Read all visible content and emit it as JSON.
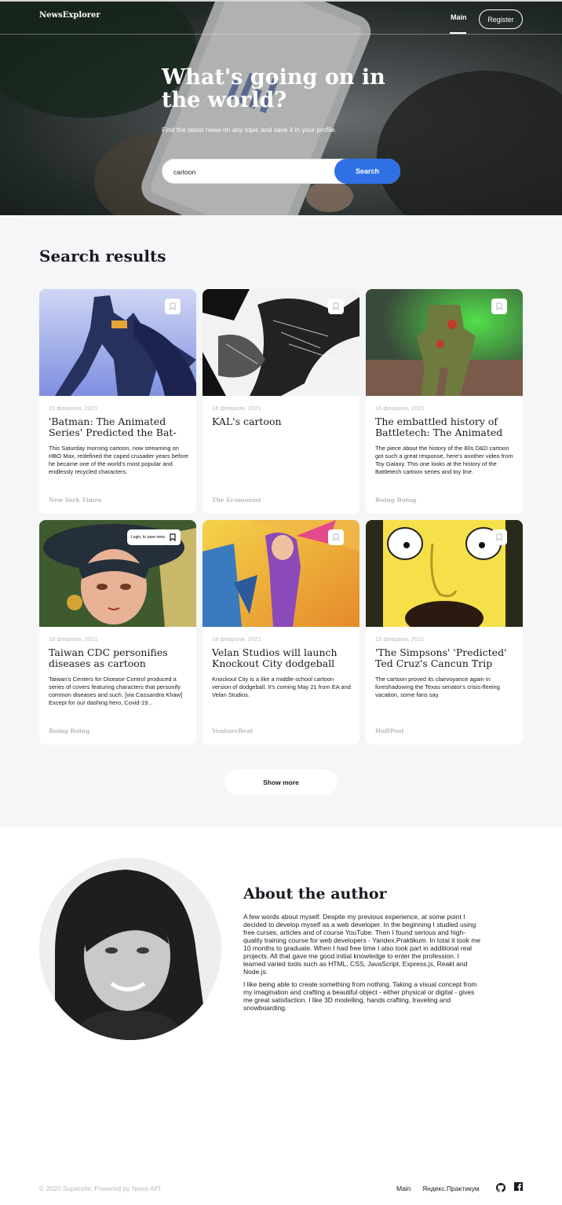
{
  "header": {
    "logo": "NewsExplorer",
    "nav_main": "Main",
    "register": "Register"
  },
  "hero": {
    "title": "What's going on in the world?",
    "subtitle": "Find the latest news on any topic and save it in your profile.",
    "search_value": "cartoon",
    "search_button": "Search"
  },
  "results": {
    "title": "Search results",
    "tooltip": "Login, to save news",
    "show_more": "Show more",
    "cards": [
      {
        "date": "21 февраля, 2021",
        "title": "'Batman: The Animated Series' Predicted the Bat-Family",
        "text": "This Saturday morning cartoon, now streaming on HBO Max, redefined the caped crusader years before he became one of the world's most popular and endlessly recycled characters.",
        "source": "New York Times",
        "icon": "bookmark-icon"
      },
      {
        "date": "18 февраля, 2021",
        "title": "KAL's cartoon",
        "text": "",
        "source": "The Economist",
        "icon": "bookmark-icon"
      },
      {
        "date": "16 февраля, 2021",
        "title": "The embattled history of Battletech: The Animated Series",
        "text": "The piece about the history of the 80s D&D cartoon got such a great response, here's another video from Toy Galaxy. This one looks at the history of the Battletech cartoon series and toy line.",
        "source": "Boing Boing",
        "icon": "bookmark-icon"
      },
      {
        "date": "18 февраля, 2021",
        "title": "Taiwan CDC personifies diseases as cartoon characters",
        "text": "Taiwan's Centers for Disease Control produced a series of covers featuring characters that personify common diseases and such. [via Cassandra Khaw] Except for our dashing hero, Covid-19...",
        "source": "Boing Boing",
        "icon": "bookmark-icon"
      },
      {
        "date": "18 февраля, 2021",
        "title": "Velan Studios will launch Knockout City dodgeball game",
        "text": "Knockout City is a like a middle-school cartoon version of dodgeball. It's coming May 21 from EA and Velan Studios.",
        "source": "VentureBeat",
        "icon": "bookmark-icon"
      },
      {
        "date": "19 февраля, 2021",
        "title": "'The Simpsons' 'Predicted' Ted Cruz's Cancun Trip Years Ago",
        "text": "The cartoon proved its clairvoyance again in foreshadowing the Texas senator's crisis-fleeing vacation, some fans say.",
        "source": "HuffPost",
        "icon": "bookmark-icon"
      }
    ]
  },
  "about": {
    "title": "About the author",
    "paragraphs": [
      "A few words about myself. Despite my previous experience, at some point I decided to develop myself as a web developer. In the beginning I studied using free curses, articles and of course YouTube. Then I found serious and high-quality training course for web developers - Yandex.Praktikum. In total it took me 10 months to graduate. When I had free time I also took part in additional real projects. All that gave me good initial knowledge to enter the profession. I learned varied tools such as HTML, CSS, JavaScript, Express.js, Reakt and Node.js.",
      "I like being able to create something from nothing. Taking a visual concept from my imagination and crafting a beautiful object - either physical or digital - gives me great satisfaction. I like 3D modelling, hands crafting, traveling and snowboarding."
    ]
  },
  "footer": {
    "copyright": "© 2020 Supersite, Powered by News API",
    "link_main": "Main",
    "link_praktikum": "Яндекс.Практикум",
    "github_icon": "github-icon",
    "facebook_icon": "facebook-icon"
  }
}
